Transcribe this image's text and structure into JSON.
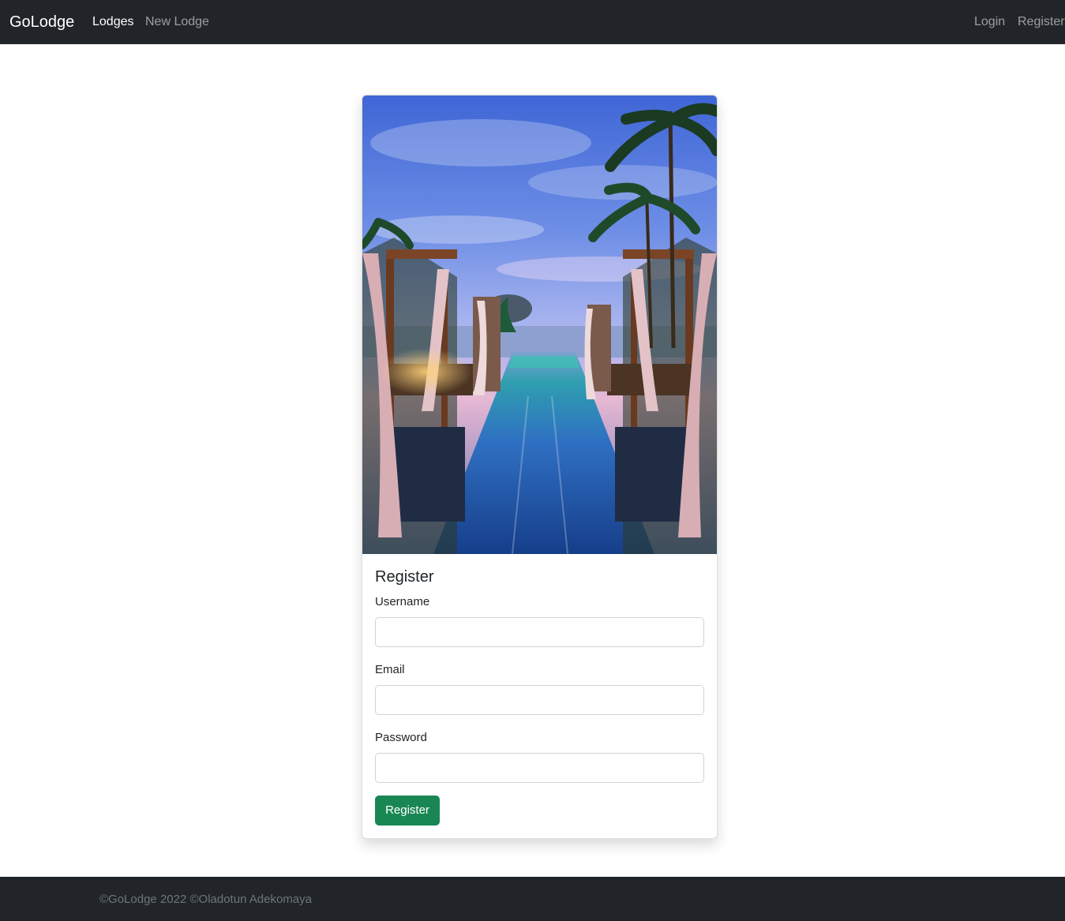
{
  "navbar": {
    "brand": "GoLodge",
    "links": [
      {
        "label": "Lodges",
        "active": true
      },
      {
        "label": "New Lodge",
        "active": false
      }
    ],
    "auth_links": [
      {
        "label": "Login"
      },
      {
        "label": "Register"
      }
    ]
  },
  "card": {
    "image_alt": "Resort infinity pool with cabanas and palm trees at dusk",
    "title": "Register",
    "fields": [
      {
        "label": "Username",
        "value": "",
        "type": "text"
      },
      {
        "label": "Email",
        "value": "",
        "type": "email"
      },
      {
        "label": "Password",
        "value": "",
        "type": "password"
      }
    ],
    "submit_label": "Register"
  },
  "footer": {
    "text": "©GoLodge 2022 ©Oladotun Adekomaya"
  },
  "colors": {
    "navbar_bg": "#212529",
    "success": "#198754",
    "muted": "#6c757d"
  }
}
